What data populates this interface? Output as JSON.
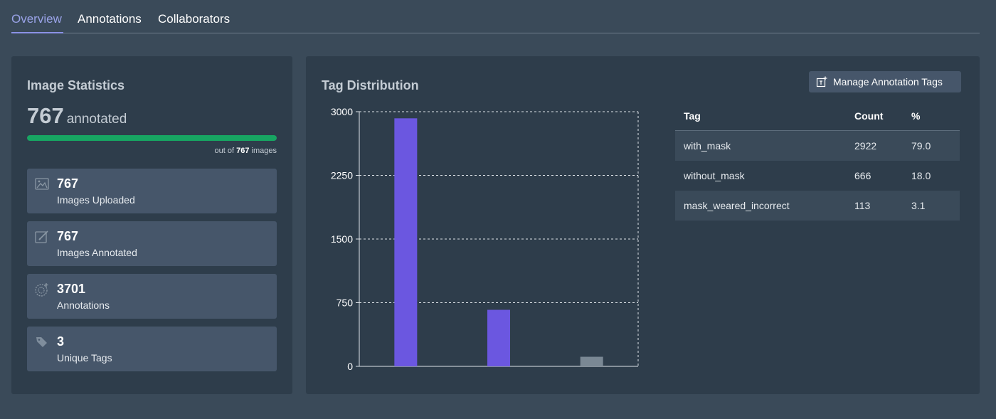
{
  "tabs": [
    {
      "label": "Overview"
    },
    {
      "label": "Annotations"
    },
    {
      "label": "Collaborators"
    }
  ],
  "image_stats": {
    "title": "Image Statistics",
    "annotated_count": "767",
    "annotated_label": "annotated",
    "progress_fraction": 1.0,
    "out_of_prefix": "out of",
    "out_of_total": "767",
    "out_of_suffix": "images",
    "cards": [
      {
        "value": "767",
        "label": "Images Uploaded",
        "icon": "image-icon"
      },
      {
        "value": "767",
        "label": "Images Annotated",
        "icon": "edit-icon"
      },
      {
        "value": "3701",
        "label": "Annotations",
        "icon": "annotations-icon"
      },
      {
        "value": "3",
        "label": "Unique Tags",
        "icon": "tag-icon"
      }
    ]
  },
  "tag_distribution": {
    "title": "Tag Distribution",
    "manage_button_label": "Manage Annotation Tags",
    "table": {
      "headers": [
        "Tag",
        "Count",
        "%"
      ],
      "rows": [
        {
          "tag": "with_mask",
          "count": "2922",
          "pct": "79.0"
        },
        {
          "tag": "without_mask",
          "count": "666",
          "pct": "18.0"
        },
        {
          "tag": "mask_weared_incorrect",
          "count": "113",
          "pct": "3.1"
        }
      ]
    }
  },
  "colors": {
    "progress": "#17a562",
    "bar_primary": "#6b57e0",
    "bar_secondary": "#7a8894",
    "active_tab": "#9aa3e8"
  },
  "chart_data": {
    "type": "bar",
    "categories": [
      "with_mask",
      "without_mask",
      "mask_weared_incorrect"
    ],
    "values": [
      2922,
      666,
      113
    ],
    "bar_colors": [
      "#6b57e0",
      "#6b57e0",
      "#7a8894"
    ],
    "yticks": [
      "0",
      "750",
      "1500",
      "2250",
      "3000"
    ],
    "ylim": [
      0,
      3000
    ],
    "grid": true,
    "xlabels_shown": false
  }
}
